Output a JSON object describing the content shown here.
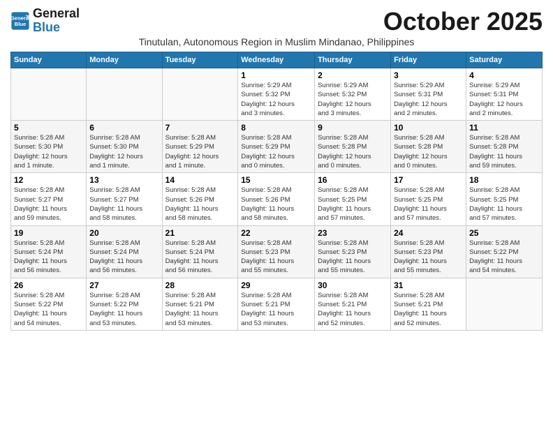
{
  "logo": {
    "line1": "General",
    "line2": "Blue"
  },
  "header": {
    "month_year": "October 2025",
    "subtitle": "Tinutulan, Autonomous Region in Muslim Mindanao, Philippines"
  },
  "days_of_week": [
    "Sunday",
    "Monday",
    "Tuesday",
    "Wednesday",
    "Thursday",
    "Friday",
    "Saturday"
  ],
  "weeks": [
    [
      {
        "day": "",
        "info": ""
      },
      {
        "day": "",
        "info": ""
      },
      {
        "day": "",
        "info": ""
      },
      {
        "day": "1",
        "info": "Sunrise: 5:29 AM\nSunset: 5:32 PM\nDaylight: 12 hours\nand 3 minutes."
      },
      {
        "day": "2",
        "info": "Sunrise: 5:29 AM\nSunset: 5:32 PM\nDaylight: 12 hours\nand 3 minutes."
      },
      {
        "day": "3",
        "info": "Sunrise: 5:29 AM\nSunset: 5:31 PM\nDaylight: 12 hours\nand 2 minutes."
      },
      {
        "day": "4",
        "info": "Sunrise: 5:29 AM\nSunset: 5:31 PM\nDaylight: 12 hours\nand 2 minutes."
      }
    ],
    [
      {
        "day": "5",
        "info": "Sunrise: 5:28 AM\nSunset: 5:30 PM\nDaylight: 12 hours\nand 1 minute."
      },
      {
        "day": "6",
        "info": "Sunrise: 5:28 AM\nSunset: 5:30 PM\nDaylight: 12 hours\nand 1 minute."
      },
      {
        "day": "7",
        "info": "Sunrise: 5:28 AM\nSunset: 5:29 PM\nDaylight: 12 hours\nand 1 minute."
      },
      {
        "day": "8",
        "info": "Sunrise: 5:28 AM\nSunset: 5:29 PM\nDaylight: 12 hours\nand 0 minutes."
      },
      {
        "day": "9",
        "info": "Sunrise: 5:28 AM\nSunset: 5:28 PM\nDaylight: 12 hours\nand 0 minutes."
      },
      {
        "day": "10",
        "info": "Sunrise: 5:28 AM\nSunset: 5:28 PM\nDaylight: 12 hours\nand 0 minutes."
      },
      {
        "day": "11",
        "info": "Sunrise: 5:28 AM\nSunset: 5:28 PM\nDaylight: 11 hours\nand 59 minutes."
      }
    ],
    [
      {
        "day": "12",
        "info": "Sunrise: 5:28 AM\nSunset: 5:27 PM\nDaylight: 11 hours\nand 59 minutes."
      },
      {
        "day": "13",
        "info": "Sunrise: 5:28 AM\nSunset: 5:27 PM\nDaylight: 11 hours\nand 58 minutes."
      },
      {
        "day": "14",
        "info": "Sunrise: 5:28 AM\nSunset: 5:26 PM\nDaylight: 11 hours\nand 58 minutes."
      },
      {
        "day": "15",
        "info": "Sunrise: 5:28 AM\nSunset: 5:26 PM\nDaylight: 11 hours\nand 58 minutes."
      },
      {
        "day": "16",
        "info": "Sunrise: 5:28 AM\nSunset: 5:25 PM\nDaylight: 11 hours\nand 57 minutes."
      },
      {
        "day": "17",
        "info": "Sunrise: 5:28 AM\nSunset: 5:25 PM\nDaylight: 11 hours\nand 57 minutes."
      },
      {
        "day": "18",
        "info": "Sunrise: 5:28 AM\nSunset: 5:25 PM\nDaylight: 11 hours\nand 57 minutes."
      }
    ],
    [
      {
        "day": "19",
        "info": "Sunrise: 5:28 AM\nSunset: 5:24 PM\nDaylight: 11 hours\nand 56 minutes."
      },
      {
        "day": "20",
        "info": "Sunrise: 5:28 AM\nSunset: 5:24 PM\nDaylight: 11 hours\nand 56 minutes."
      },
      {
        "day": "21",
        "info": "Sunrise: 5:28 AM\nSunset: 5:24 PM\nDaylight: 11 hours\nand 56 minutes."
      },
      {
        "day": "22",
        "info": "Sunrise: 5:28 AM\nSunset: 5:23 PM\nDaylight: 11 hours\nand 55 minutes."
      },
      {
        "day": "23",
        "info": "Sunrise: 5:28 AM\nSunset: 5:23 PM\nDaylight: 11 hours\nand 55 minutes."
      },
      {
        "day": "24",
        "info": "Sunrise: 5:28 AM\nSunset: 5:23 PM\nDaylight: 11 hours\nand 55 minutes."
      },
      {
        "day": "25",
        "info": "Sunrise: 5:28 AM\nSunset: 5:22 PM\nDaylight: 11 hours\nand 54 minutes."
      }
    ],
    [
      {
        "day": "26",
        "info": "Sunrise: 5:28 AM\nSunset: 5:22 PM\nDaylight: 11 hours\nand 54 minutes."
      },
      {
        "day": "27",
        "info": "Sunrise: 5:28 AM\nSunset: 5:22 PM\nDaylight: 11 hours\nand 53 minutes."
      },
      {
        "day": "28",
        "info": "Sunrise: 5:28 AM\nSunset: 5:21 PM\nDaylight: 11 hours\nand 53 minutes."
      },
      {
        "day": "29",
        "info": "Sunrise: 5:28 AM\nSunset: 5:21 PM\nDaylight: 11 hours\nand 53 minutes."
      },
      {
        "day": "30",
        "info": "Sunrise: 5:28 AM\nSunset: 5:21 PM\nDaylight: 11 hours\nand 52 minutes."
      },
      {
        "day": "31",
        "info": "Sunrise: 5:28 AM\nSunset: 5:21 PM\nDaylight: 11 hours\nand 52 minutes."
      },
      {
        "day": "",
        "info": ""
      }
    ]
  ]
}
